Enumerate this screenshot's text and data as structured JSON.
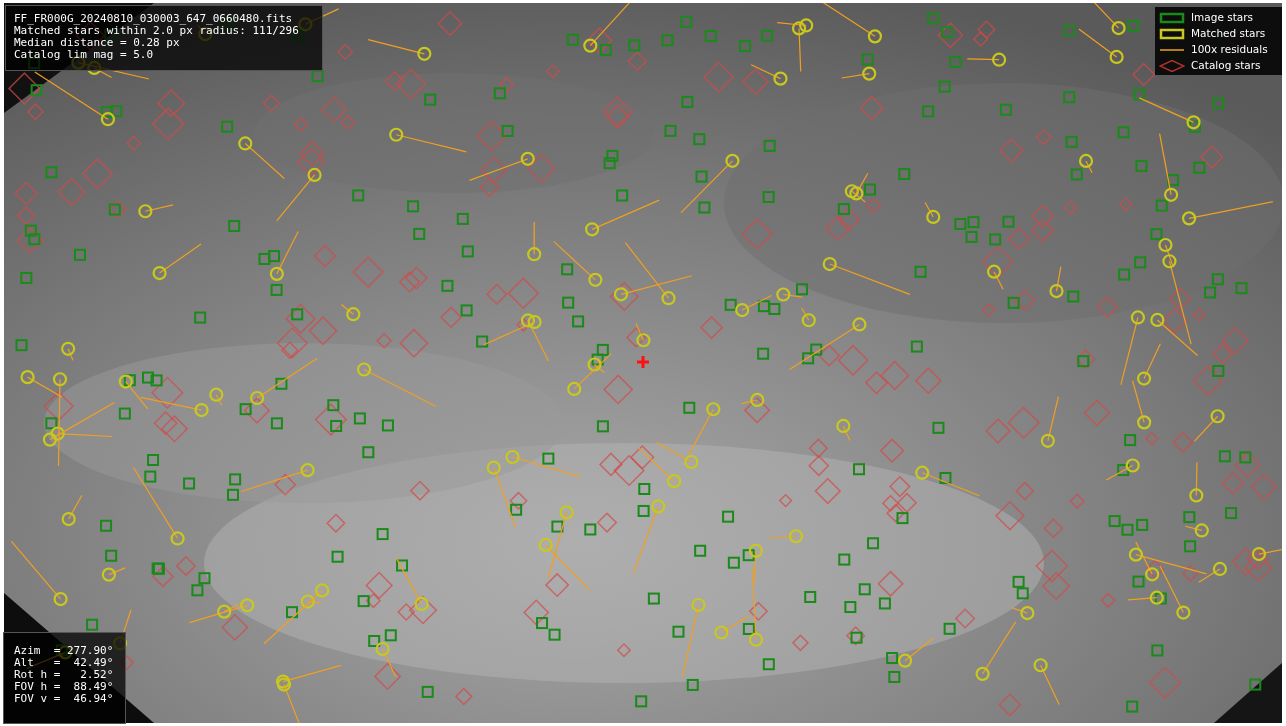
{
  "info_box": {
    "lines": [
      "FF_FR000G_20240810_030003_647_0660480.fits",
      "Matched stars within 2.0 px radius: 111/296",
      "Median distance = 0.28 px",
      "Catalog lim mag = 5.0"
    ]
  },
  "legend": {
    "items": [
      {
        "label": "Image stars"
      },
      {
        "label": "Matched stars",
        "kind": "matched"
      },
      {
        "label": "100x residuals",
        "kind": "residual"
      },
      {
        "label": "Catalog stars",
        "kind": "catalog"
      }
    ]
  },
  "pointing_box": {
    "lines": [
      "Azim  = 277.90°",
      "Alt   =  42.49°",
      "Rot h =   2.52°",
      "FOV h =  88.49°",
      "FOV v =  46.94°"
    ]
  }
}
